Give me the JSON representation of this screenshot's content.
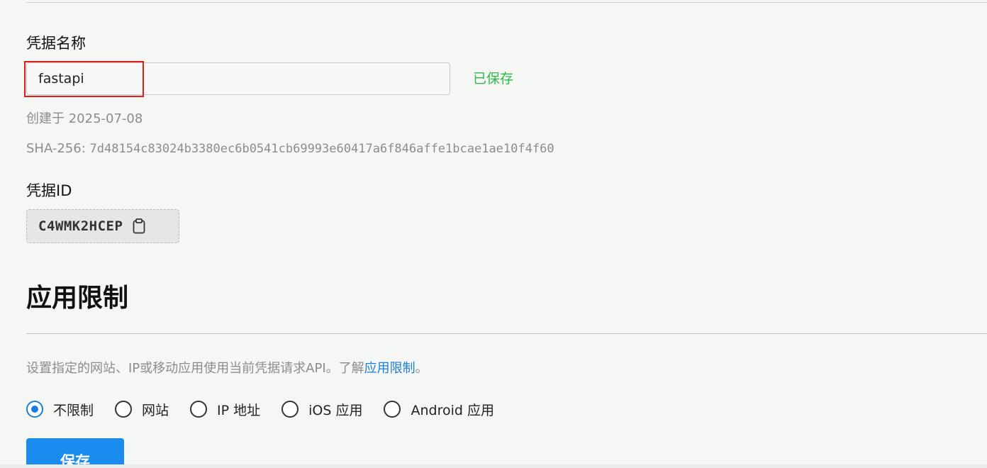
{
  "credential": {
    "name_label": "凭据名称",
    "name_value": "fastapi",
    "saved_status": "已保存",
    "created_text": "创建于 2025-07-08",
    "sha_prefix": "SHA-256: ",
    "sha_value": "7d48154c83024b3380ec6b0541cb69993e60417a6f846affe1bcae1ae10f4f60",
    "id_label": "凭据ID",
    "id_value": "C4WMK2HCEP",
    "copy_icon": "clipboard-icon"
  },
  "restrictions": {
    "title": "应用限制",
    "description_prefix": "设置指定的网站、IP或移动应用使用当前凭据请求API。了解",
    "description_link": "应用限制",
    "description_suffix": "。",
    "options": [
      {
        "label": "不限制",
        "checked": true
      },
      {
        "label": "网站",
        "checked": false
      },
      {
        "label": "IP 地址",
        "checked": false
      },
      {
        "label": "iOS 应用",
        "checked": false
      },
      {
        "label": "Android 应用",
        "checked": false
      }
    ],
    "save_label": "保存"
  },
  "colors": {
    "accent": "#1a8cf0",
    "link": "#1a7fd8",
    "saved": "#2fb84a",
    "highlight": "#e11a1a"
  }
}
